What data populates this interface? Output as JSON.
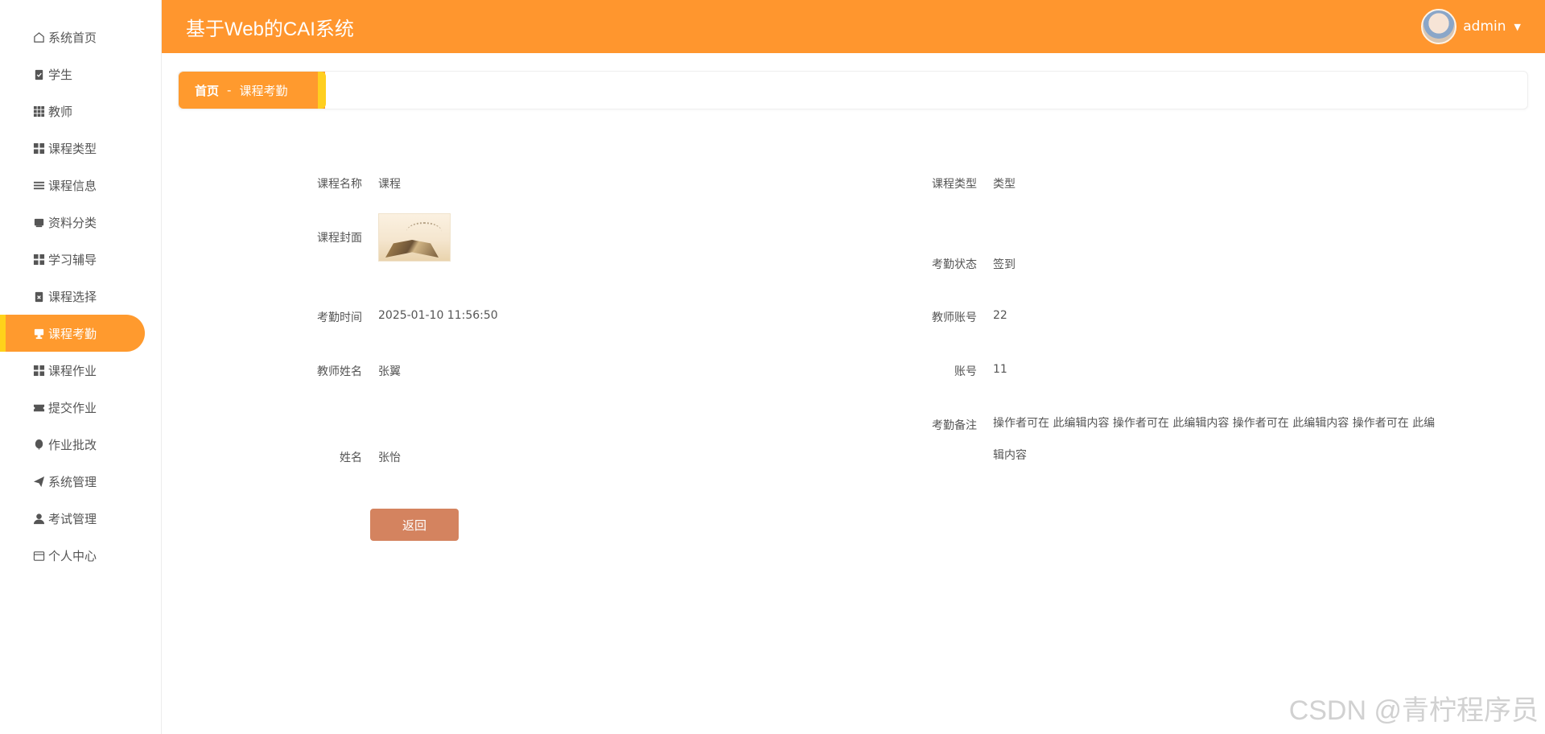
{
  "sidebar": {
    "items": [
      {
        "label": "系统首页",
        "icon": "home-icon"
      },
      {
        "label": "学生",
        "icon": "clipboard-check-icon"
      },
      {
        "label": "教师",
        "icon": "grid-icon"
      },
      {
        "label": "课程类型",
        "icon": "apps-icon"
      },
      {
        "label": "课程信息",
        "icon": "list-icon"
      },
      {
        "label": "资料分类",
        "icon": "box-icon"
      },
      {
        "label": "学习辅导",
        "icon": "apps-icon"
      },
      {
        "label": "课程选择",
        "icon": "clipboard-x-icon"
      },
      {
        "label": "课程考勤",
        "icon": "cup-icon",
        "active": true
      },
      {
        "label": "课程作业",
        "icon": "apps-icon"
      },
      {
        "label": "提交作业",
        "icon": "ticket-icon"
      },
      {
        "label": "作业批改",
        "icon": "balloon-icon"
      },
      {
        "label": "系统管理",
        "icon": "paper-plane-icon"
      },
      {
        "label": "考试管理",
        "icon": "user-icon"
      },
      {
        "label": "个人中心",
        "icon": "wallet-icon"
      }
    ]
  },
  "header": {
    "title": "基于Web的CAI系统",
    "user": "admin"
  },
  "breadcrumb": {
    "home": "首页",
    "separator": "-",
    "current": "课程考勤"
  },
  "detail": {
    "course_name_label": "课程名称",
    "course_name": "课程",
    "course_type_label": "课程类型",
    "course_type": "类型",
    "cover_label": "课程封面",
    "status_label": "考勤状态",
    "status": "签到",
    "time_label": "考勤时间",
    "time": "2025-01-10 11:56:50",
    "teacher_account_label": "教师账号",
    "teacher_account": "22",
    "teacher_name_label": "教师姓名",
    "teacher_name": "张翼",
    "account_label": "账号",
    "account": "11",
    "note_label": "考勤备注",
    "note": "操作者可在 此编辑内容 操作者可在 此编辑内容 操作者可在 此编辑内容 操作者可在 此编辑内容",
    "name_label": "姓名",
    "name": "张怡"
  },
  "actions": {
    "back_label": "返回"
  },
  "watermark": "CSDN @青柠程序员",
  "colors": {
    "accent": "#ff962e",
    "accent_stripe": "#ffd21a",
    "button": "#d4835f"
  }
}
